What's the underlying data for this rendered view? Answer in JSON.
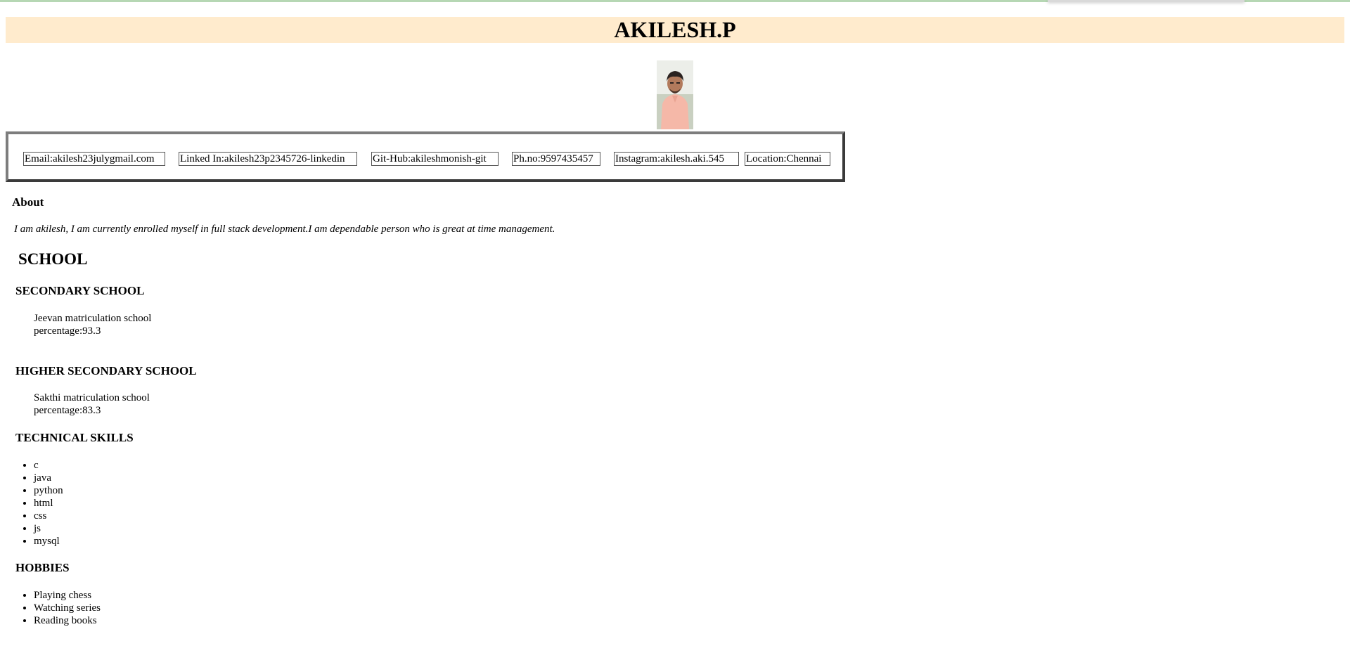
{
  "header": {
    "name": "AKILESH.P"
  },
  "contacts": [
    {
      "label": "Email:akilesh23julygmail.com"
    },
    {
      "label": "Linked In:akilesh23p2345726-linkedin"
    },
    {
      "label": "Git-Hub:akileshmonish-git"
    },
    {
      "label": "Ph.no:9597435457"
    },
    {
      "label": "Instagram:akilesh.aki.545"
    },
    {
      "label": "Location:Chennai"
    }
  ],
  "about": {
    "title": "About",
    "text": "I am akilesh, I am currently enrolled myself in full stack development.I am dependable person who is great at time management."
  },
  "school": {
    "title": "SCHOOL",
    "secondary": {
      "title": "SECONDARY SCHOOL",
      "name": "Jeevan matriculation school",
      "percentage": "percentage:93.3"
    },
    "higher_secondary": {
      "title": "HIGHER SECONDARY SCHOOL",
      "name": "Sakthi matriculation school",
      "percentage": "percentage:83.3"
    }
  },
  "skills": {
    "title": "TECHNICAL SKILLS",
    "items": [
      "c",
      "java",
      "python",
      "html",
      "css",
      "js",
      "mysql"
    ]
  },
  "hobbies": {
    "title": "HOBBIES",
    "items": [
      "Playing chess",
      "Watching series",
      "Reading books"
    ]
  },
  "colors": {
    "title_background": "#ffebcd",
    "top_border": "#b6d7b4"
  }
}
